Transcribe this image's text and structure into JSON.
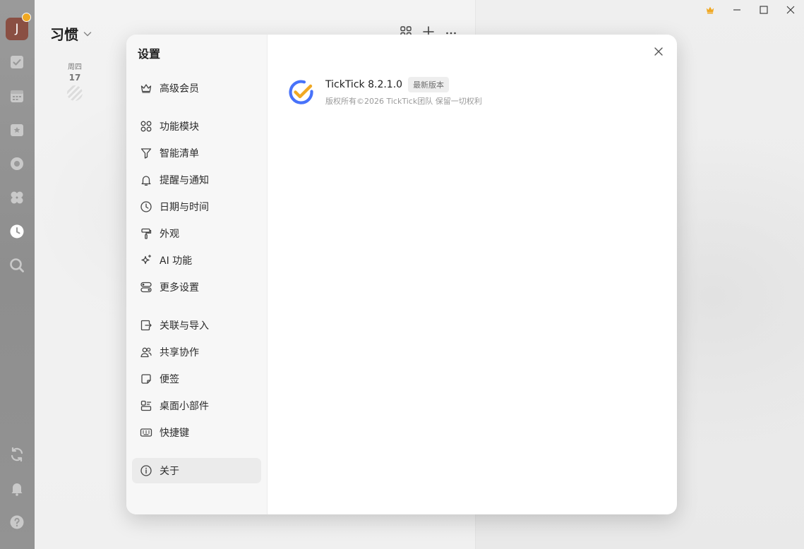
{
  "app": {
    "avatar_letter": "J",
    "accent": "#f0a823"
  },
  "list": {
    "title": "习惯",
    "day": {
      "weekday": "周四",
      "date": "17"
    }
  },
  "settings": {
    "title": "设置",
    "menu": [
      {
        "label": "高级会员",
        "icon": "crown-icon"
      },
      {
        "label": "功能模块",
        "icon": "grid-icon"
      },
      {
        "label": "智能清单",
        "icon": "filter-icon"
      },
      {
        "label": "提醒与通知",
        "icon": "bell-icon"
      },
      {
        "label": "日期与时间",
        "icon": "clock-icon"
      },
      {
        "label": "外观",
        "icon": "paint-roller-icon"
      },
      {
        "label": "AI 功能",
        "icon": "sparkle-icon"
      },
      {
        "label": "更多设置",
        "icon": "toggles-icon"
      },
      {
        "label": "关联与导入",
        "icon": "import-icon"
      },
      {
        "label": "共享协作",
        "icon": "users-icon"
      },
      {
        "label": "便签",
        "icon": "sticky-note-icon"
      },
      {
        "label": "桌面小部件",
        "icon": "widget-icon"
      },
      {
        "label": "快捷键",
        "icon": "keyboard-icon"
      },
      {
        "label": "关于",
        "icon": "info-icon"
      }
    ],
    "active_item": "关于"
  },
  "about": {
    "app_name": "TickTick 8.2.1.0",
    "version_badge": "最新版本",
    "copyright": "版权所有©2026 TickTick团队 保留一切权利",
    "logo_colors": {
      "ring": "#4772fa",
      "check": "#f0a823"
    }
  }
}
